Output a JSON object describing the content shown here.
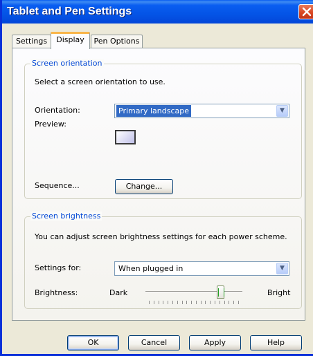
{
  "window": {
    "title": "Tablet and Pen Settings",
    "close_icon": "close-icon"
  },
  "tabs": [
    {
      "label": "Settings",
      "active": false
    },
    {
      "label": "Display",
      "active": true
    },
    {
      "label": "Pen Options",
      "active": false
    }
  ],
  "screen_orientation": {
    "legend": "Screen orientation",
    "description": "Select a screen orientation to use.",
    "orientation_label": "Orientation:",
    "orientation_value": "Primary landscape",
    "preview_label": "Preview:",
    "preview_icon": "landscape-preview-icon",
    "sequence_label": "Sequence...",
    "change_button": "Change..."
  },
  "screen_brightness": {
    "legend": "Screen brightness",
    "description": "You can adjust screen brightness settings for each power scheme.",
    "settings_for_label": "Settings for:",
    "settings_for_value": "When plugged in",
    "brightness_label": "Brightness:",
    "dark_label": "Dark",
    "bright_label": "Bright",
    "brightness_level_fraction": 0.8,
    "tick_count": 20
  },
  "buttons": {
    "ok": "OK",
    "cancel": "Cancel",
    "apply": "Apply",
    "help": "Help"
  },
  "colors": {
    "titlebar": "#0a5ef1",
    "legend_text": "#0046d5",
    "selection": "#316ac5",
    "close_button": "#d8441f"
  }
}
